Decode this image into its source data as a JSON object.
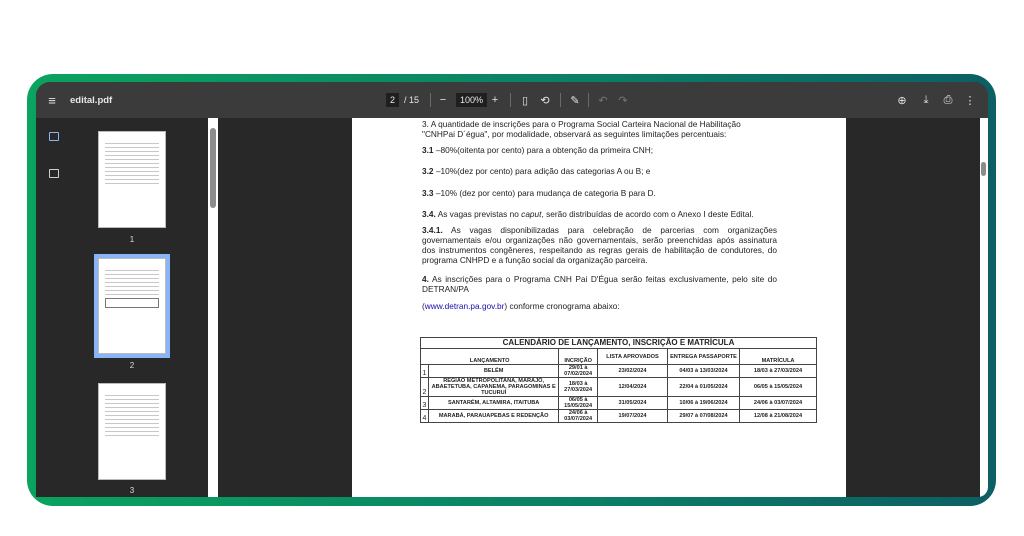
{
  "toolbar": {
    "filename": "edital.pdf",
    "page_current": "2",
    "page_total": "/ 15",
    "zoom": "100%",
    "menu_icon": "hamburger-icon",
    "zoom_out": "−",
    "zoom_in": "+"
  },
  "sidebar": {
    "thumbnails": [
      {
        "label": "1"
      },
      {
        "label": "2",
        "selected": true
      },
      {
        "label": "3"
      }
    ]
  },
  "document": {
    "p3_line1": "3. A quantidade de inscrições para o Programa Social Carteira Nacional de Habilitação",
    "p3_line2": "\"CNHPai D´égua\", por modalidade, observará as seguintes limitações percentuais:",
    "p31_num": "3.1",
    "p31": " –80%(oitenta por cento) para a obtenção da primeira CNH;",
    "p32_num": "3.2",
    "p32": " –10%(dez por cento) para adição das categorias A ou B; e",
    "p33_num": "3.3",
    "p33": " –10% (dez por cento) para mudança de categoria B para D.",
    "p34_num": "3.4.",
    "p34a": " As vagas previstas no ",
    "p34_caput": "caput",
    "p34b": ", serão distribuídas de acordo com o Anexo I deste Edital.",
    "p341_num": "3.4.1.",
    "p341": " As vagas disponibilizadas para celebração de parcerias com organizações governamentais e/ou organizações não governamentais, serão preenchidas após assinatura dos instrumentos congêneres, respeitando as regras gerais de habilitação de condutores, do programa CNHPD e a função social da organização parceira.",
    "p4_num": "4.",
    "p4": " As inscrições para o Programa CNH Pai D'Égua serão feitas exclusivamente, pelo site do DETRAN/PA",
    "link": "www.detran.pa.gov.br",
    "link_after": ") conforme cronograma abaixo:",
    "link_before": "("
  },
  "table": {
    "title": "CALENDÁRIO DE LANÇAMENTO, INSCRIÇÃO E MATRÍCULA",
    "headers": [
      "LANÇAMENTO",
      "INCRIÇÃO",
      "LISTA APROVADOS",
      "ENTREGA PASSAPORTE",
      "MATRÍCULA"
    ],
    "rows": [
      [
        "1",
        "BELÉM",
        "29/01 à 07/02/2024",
        "23/02/2024",
        "04/03 à 13/03/2024",
        "18/03 à 27/03/2024"
      ],
      [
        "2",
        "REGIÃO METROPOLITANA, MARAJÓ, ABAETETUBA, CAPANEMA, PARAGOMINAS E TUCURUÍ",
        "18/03 à 27/03/2024",
        "12/04/2024",
        "22/04 à 01/05/2024",
        "06/05 à 15/05/2024"
      ],
      [
        "3",
        "SANTARÉM, ALTAMIRA, ITAITUBA",
        "06/05 à 15/05/2024",
        "31/05/2024",
        "10/06 à 19/06/2024",
        "24/06 à 03/07/2024"
      ],
      [
        "4",
        "MARABÁ, PARAUAPEBAS E REDENÇÃO",
        "24/06 à 03/07/2024",
        "19/07/2024",
        "29/07 à 07/08/2024",
        "12/08 à 21/08/2024"
      ]
    ]
  }
}
